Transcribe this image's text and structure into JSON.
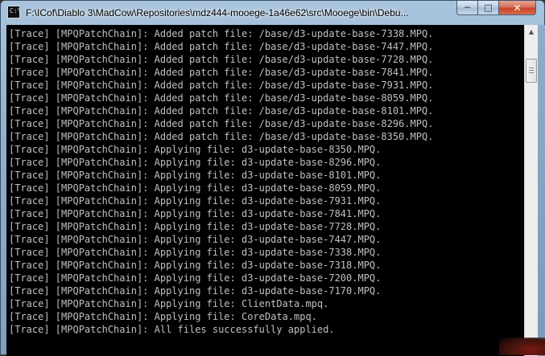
{
  "window": {
    "title": "F:\\ICof\\Diablo 3\\MadCow\\Repositories\\mdz444-mooege-1a46e62\\src\\Mooege\\bin\\Debu...",
    "icon": "console-icon",
    "icon_glyph": "C:\\",
    "controls": {
      "minimize_glyph": "─",
      "maximize_glyph": "□",
      "close_glyph": "✕"
    }
  },
  "console": {
    "background": "#000000",
    "text_color": "#c0c0c0",
    "lines": [
      "[Trace] [MPQPatchChain]: Added patch file: /base/d3-update-base-7338.MPQ.",
      "[Trace] [MPQPatchChain]: Added patch file: /base/d3-update-base-7447.MPQ.",
      "[Trace] [MPQPatchChain]: Added patch file: /base/d3-update-base-7728.MPQ.",
      "[Trace] [MPQPatchChain]: Added patch file: /base/d3-update-base-7841.MPQ.",
      "[Trace] [MPQPatchChain]: Added patch file: /base/d3-update-base-7931.MPQ.",
      "[Trace] [MPQPatchChain]: Added patch file: /base/d3-update-base-8059.MPQ.",
      "[Trace] [MPQPatchChain]: Added patch file: /base/d3-update-base-8101.MPQ.",
      "[Trace] [MPQPatchChain]: Added patch file: /base/d3-update-base-8296.MPQ.",
      "[Trace] [MPQPatchChain]: Added patch file: /base/d3-update-base-8350.MPQ.",
      "[Trace] [MPQPatchChain]: Applying file: d3-update-base-8350.MPQ.",
      "[Trace] [MPQPatchChain]: Applying file: d3-update-base-8296.MPQ.",
      "[Trace] [MPQPatchChain]: Applying file: d3-update-base-8101.MPQ.",
      "[Trace] [MPQPatchChain]: Applying file: d3-update-base-8059.MPQ.",
      "[Trace] [MPQPatchChain]: Applying file: d3-update-base-7931.MPQ.",
      "[Trace] [MPQPatchChain]: Applying file: d3-update-base-7841.MPQ.",
      "[Trace] [MPQPatchChain]: Applying file: d3-update-base-7728.MPQ.",
      "[Trace] [MPQPatchChain]: Applying file: d3-update-base-7447.MPQ.",
      "[Trace] [MPQPatchChain]: Applying file: d3-update-base-7338.MPQ.",
      "[Trace] [MPQPatchChain]: Applying file: d3-update-base-7318.MPQ.",
      "[Trace] [MPQPatchChain]: Applying file: d3-update-base-7200.MPQ.",
      "[Trace] [MPQPatchChain]: Applying file: d3-update-base-7170.MPQ.",
      "[Trace] [MPQPatchChain]: Applying file: ClientData.mpq.",
      "[Trace] [MPQPatchChain]: Applying file: CoreData.mpq.",
      "[Trace] [MPQPatchChain]: All files successfully applied."
    ]
  },
  "scrollbar": {
    "up_arrow_icon": "chevron-up-icon",
    "up_glyph": "▲"
  }
}
